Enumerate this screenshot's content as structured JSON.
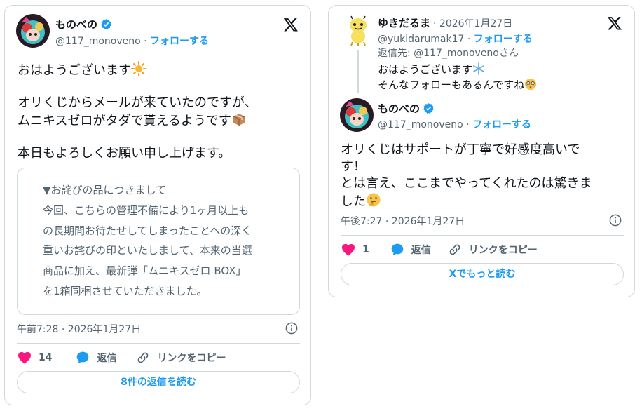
{
  "card1": {
    "author": {
      "display_name": "ものべの",
      "handle": "@117_monoveno",
      "follow_label": "フォローする"
    },
    "text_lines": [
      "おはようございます",
      "",
      "オリくじからメールが来ていたのですが、",
      "ムニキスゼロがタダで貰えるようです",
      "",
      "本日もよろしくお願い申し上げます。"
    ],
    "quote_lines": [
      "▼お詫びの品につきまして",
      "今回、こちらの管理不備により1ヶ月以上も",
      "の長期間お待たせしてしまったことへの深く",
      "重いお詫びの印といたしまして、本来の当選",
      "商品に加え、最新弾「ムニキスゼロ BOX」",
      "を1箱同梱させていただきました。"
    ],
    "timestamp": "午前7:28 · 2026年1月27日",
    "likes": "14",
    "reply_label": "返信",
    "copy_link_label": "リンクをコピー",
    "read_replies_label": "8件の返信を読む"
  },
  "card2": {
    "reply_author": {
      "display_name": "ゆきだるま",
      "date": "· 2026年1月27日",
      "handle": "@yukidarumak17",
      "follow_label": "フォローする",
      "reply_to": "返信先: @117_monovenoさん"
    },
    "reply_lines": [
      "おはようございます",
      "そんなフォローもあるんですね"
    ],
    "author": {
      "display_name": "ものべの",
      "handle": "@117_monoveno",
      "follow_label": "フォローする"
    },
    "text_lines": [
      "オリくじはサポートが丁寧で好感度高いで",
      "す！",
      "とは言え、ここまでやってくれたのは驚きま",
      "した"
    ],
    "timestamp": "午後7:27 · 2026年1月27日",
    "likes": "1",
    "reply_label": "返信",
    "copy_link_label": "リンクをコピー",
    "read_more_label": "Xでもっと読む"
  },
  "colors": {
    "accent": "#1d9bf0",
    "like": "#f91880",
    "muted": "#536471",
    "border": "#cfd9de"
  },
  "icons": [
    "verified-badge-icon",
    "x-logo-icon",
    "info-icon",
    "heart-icon",
    "reply-bubble-icon",
    "link-icon",
    "sun-emoji",
    "package-emoji",
    "snowflake-emoji",
    "flushed-face-emoji",
    "thinking-face-emoji"
  ]
}
